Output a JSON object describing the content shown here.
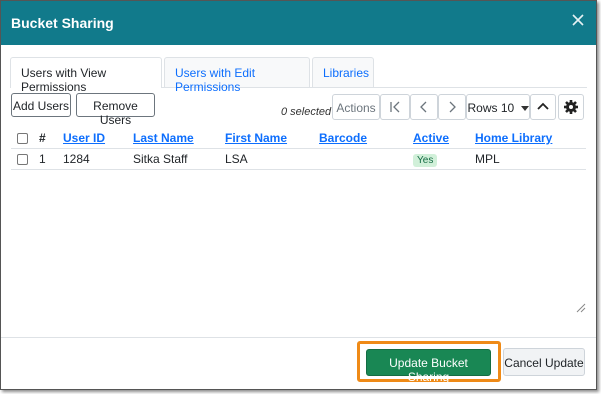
{
  "dialog": {
    "title": "Bucket Sharing",
    "close_label": "×"
  },
  "tabs": [
    {
      "label": "Users with View Permissions",
      "active": true
    },
    {
      "label": "Users with Edit Permissions",
      "active": false
    },
    {
      "label": "Libraries",
      "active": false
    }
  ],
  "toolbar": {
    "add_users": "Add Users",
    "remove_users": "Remove Users",
    "selected_text": "0 selected",
    "actions": "Actions",
    "first_page": "|<",
    "prev_page": "<",
    "next_page": ">",
    "rows": "Rows 10"
  },
  "grid": {
    "columns": [
      "#",
      "User ID",
      "Last Name",
      "First Name",
      "Barcode",
      "Active",
      "Home Library"
    ],
    "rows": [
      {
        "index": "1",
        "user_id": "1284",
        "last_name": "Sitka Staff",
        "first_name": "LSA",
        "barcode": "",
        "active": "Yes",
        "home_library": "MPL"
      }
    ]
  },
  "footer": {
    "update_button": "Update Bucket Sharing",
    "cancel_button": "Cancel Update"
  },
  "colors": {
    "header": "#117a8b",
    "success": "#198754",
    "highlight": "#ef8a17",
    "link": "#0d6efd"
  }
}
